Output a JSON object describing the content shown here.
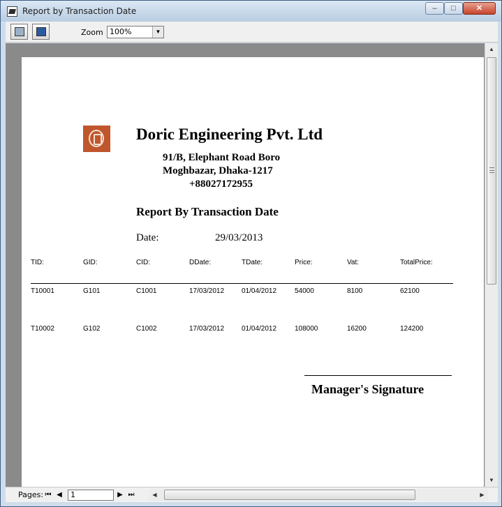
{
  "window": {
    "title": "Report by Transaction Date",
    "buttons": {
      "minimize": "–",
      "maximize": "□",
      "close": "✕"
    }
  },
  "toolbar": {
    "print_icon": "print-icon",
    "export_icon": "export-icon",
    "zoom_label": "Zoom",
    "zoom_value": "100%"
  },
  "report": {
    "company": "Doric Engineering Pvt. Ltd",
    "address_line1": "91/B, Elephant Road Boro",
    "address_line2": "Moghbazar, Dhaka-1217",
    "phone": "+88027172955",
    "title": "Report By Transaction Date",
    "date_label": "Date:",
    "date_value": "29/03/2013",
    "columns": [
      "TID:",
      "GID:",
      "CID:",
      "DDate:",
      "TDate:",
      "Price:",
      "Vat:",
      "TotalPrice:"
    ],
    "rows": [
      [
        "T10001",
        "G101",
        "C1001",
        "17/03/2012",
        "01/04/2012",
        "54000",
        "8100",
        "62100"
      ],
      [
        "T10002",
        "G102",
        "C1002",
        "17/03/2012",
        "01/04/2012",
        "108000",
        "16200",
        "124200"
      ]
    ],
    "signature": "Manager's Signature"
  },
  "pager": {
    "label": "Pages:",
    "current_page": "1"
  }
}
